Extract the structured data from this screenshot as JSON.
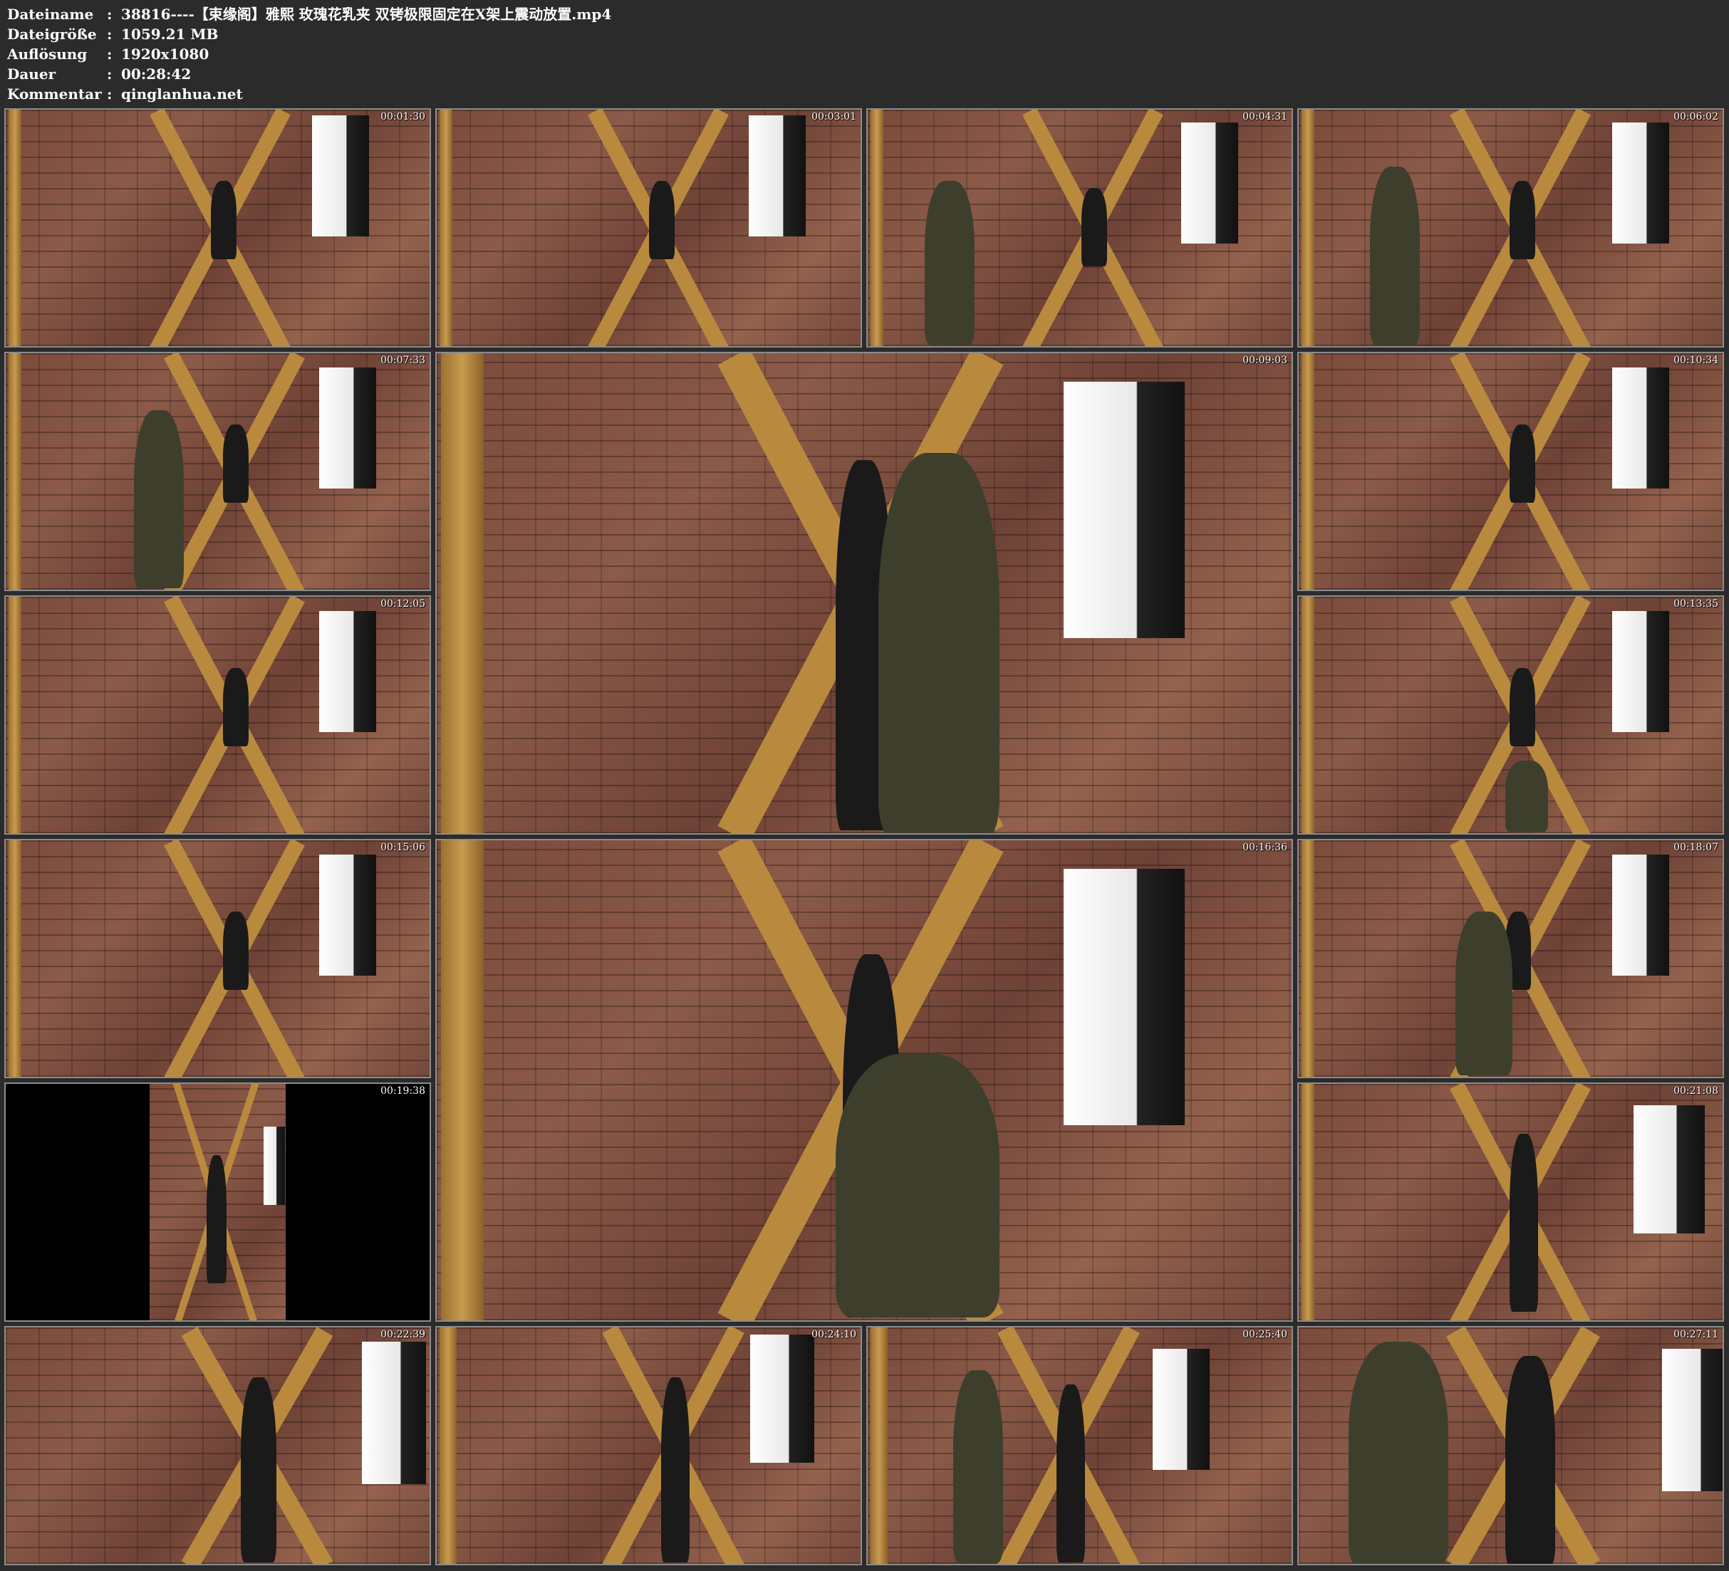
{
  "info": {
    "rows": [
      {
        "key": "Dateiname",
        "sep": ":",
        "value": "38816----【束缘阁】雅熙 玫瑰花乳夹 双铐极限固定在X架上震动放置.mp4"
      },
      {
        "key": "Dateigröße",
        "sep": ":",
        "value": "1059.21 MB"
      },
      {
        "key": "Auflösung",
        "sep": ":",
        "value": "1920x1080"
      },
      {
        "key": "Dauer",
        "sep": ":",
        "value": "00:28:42"
      },
      {
        "key": "Kommentar",
        "sep": ":",
        "value": "qinglanhua.net"
      }
    ]
  },
  "thumbnails": [
    {
      "timestamp": "00:01:30"
    },
    {
      "timestamp": "00:03:01"
    },
    {
      "timestamp": "00:04:31"
    },
    {
      "timestamp": "00:06:02"
    },
    {
      "timestamp": "00:07:33"
    },
    {
      "timestamp": "00:09:03"
    },
    {
      "timestamp": "00:10:34"
    },
    {
      "timestamp": "00:12:05"
    },
    {
      "timestamp": "00:13:35"
    },
    {
      "timestamp": "00:15:06"
    },
    {
      "timestamp": "00:16:36"
    },
    {
      "timestamp": "00:18:07"
    },
    {
      "timestamp": "00:19:38"
    },
    {
      "timestamp": "00:21:08"
    },
    {
      "timestamp": "00:22:39"
    },
    {
      "timestamp": "00:24:10"
    },
    {
      "timestamp": "00:25:40"
    },
    {
      "timestamp": "00:27:11"
    }
  ]
}
